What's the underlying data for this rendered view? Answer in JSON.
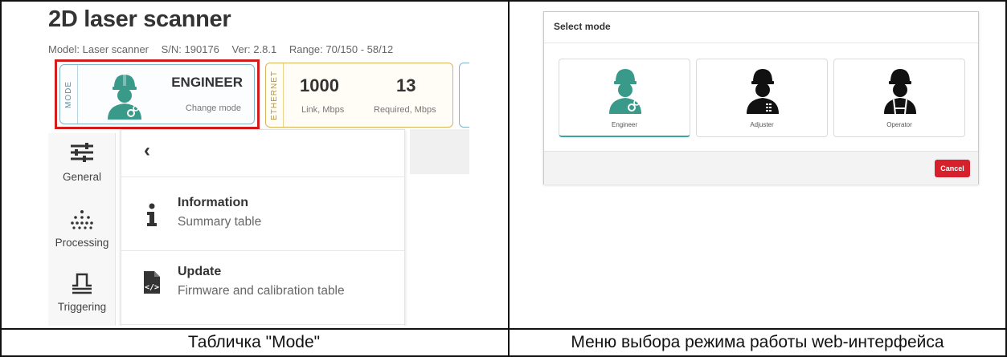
{
  "left_panel": {
    "app_title": "2D laser scanner",
    "info": {
      "model": "Model: Laser scanner",
      "serial": "S/N: 190176",
      "version": "Ver: 2.8.1",
      "range": "Range: 70/150 - 58/12"
    },
    "mode_card": {
      "side_label": "MODE",
      "mode_name": "ENGINEER",
      "action_label": "Change mode"
    },
    "ethernet_card": {
      "side_label": "ETHERNET",
      "link_value": "1000",
      "link_label": "Link, Mbps",
      "required_value": "13",
      "required_label": "Required, Mbps"
    },
    "sidebar": {
      "items": [
        {
          "label": "General",
          "icon": "sliders-icon"
        },
        {
          "label": "Processing",
          "icon": "dots-icon"
        },
        {
          "label": "Triggering",
          "icon": "trigger-icon"
        }
      ]
    },
    "submenu": {
      "back_glyph": "‹",
      "items": [
        {
          "title": "Information",
          "subtitle": "Summary table",
          "icon": "info-icon"
        },
        {
          "title": "Update",
          "subtitle": "Firmware and calibration table",
          "icon": "code-file-icon"
        }
      ]
    },
    "caption": "Табличка \"Mode\""
  },
  "right_panel": {
    "dialog": {
      "title": "Select mode",
      "options": [
        {
          "label": "Engineer",
          "icon": "engineer-icon",
          "color": "#3a9a8a",
          "selected": true
        },
        {
          "label": "Adjuster",
          "icon": "adjuster-icon",
          "color": "#111111",
          "selected": false
        },
        {
          "label": "Operator",
          "icon": "operator-icon",
          "color": "#111111",
          "selected": false
        }
      ],
      "cancel_label": "Cancel"
    },
    "caption": "Меню выбора режима работы web-интерфейса"
  },
  "colors": {
    "highlight_border": "#d31c1c",
    "engineer_teal": "#3a9a8a",
    "cancel_red": "#d6202b"
  }
}
